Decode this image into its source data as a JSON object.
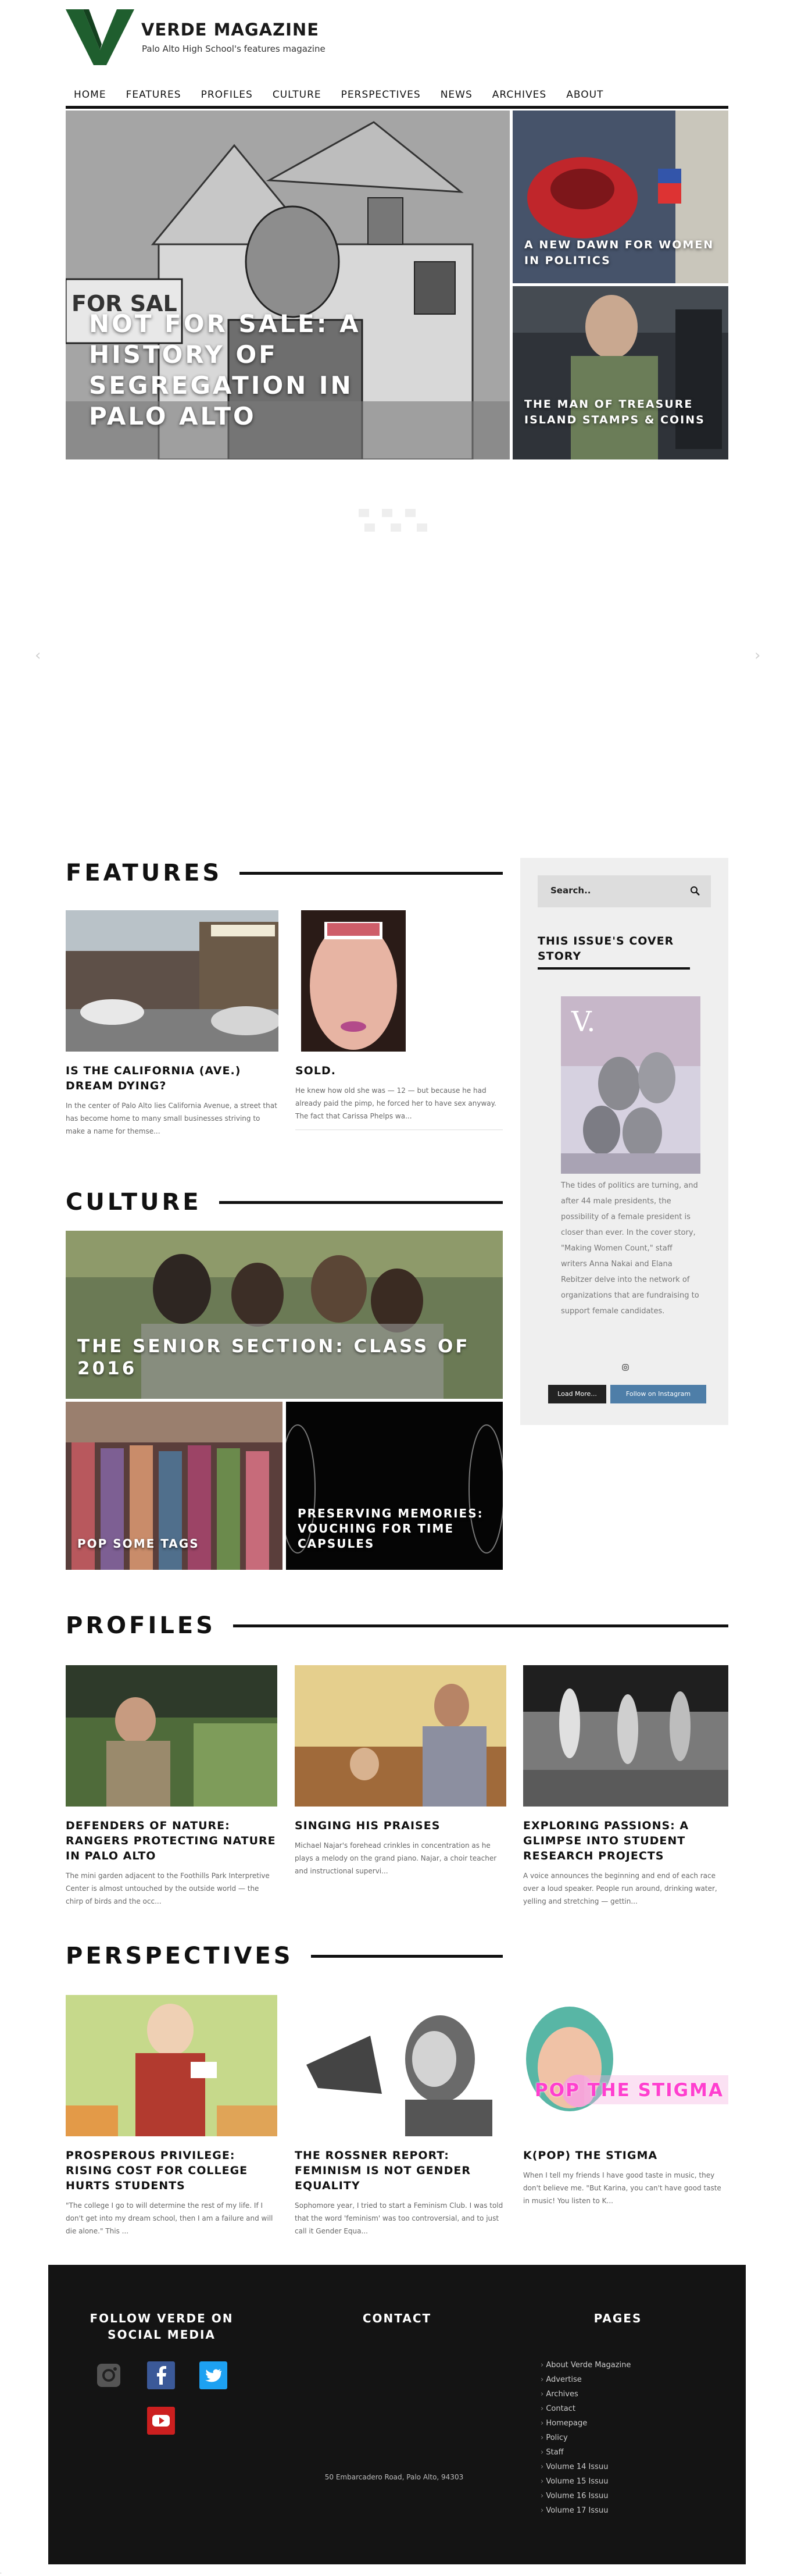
{
  "brand": {
    "title": "VERDE MAGAZINE",
    "subtitle": "Palo Alto High School's features magazine",
    "logo_letter": "V",
    "accent": "#1f5e2e"
  },
  "nav": {
    "items": [
      "HOME",
      "FEATURES",
      "PROFILES",
      "CULTURE",
      "PERSPECTIVES",
      "NEWS",
      "ARCHIVES",
      "ABOUT"
    ]
  },
  "hero": {
    "main_title": "NOT FOR SALE: A HISTORY OF SEGREGATION IN PALO ALTO",
    "side1_title": "A NEW DAWN FOR WOMEN IN POLITICS",
    "side2_title": "THE MAN OF TREASURE ISLAND STAMPS & COINS",
    "prev_arrow": "‹",
    "next_arrow": "›"
  },
  "features": {
    "heading": "FEATURES",
    "cards": [
      {
        "title": "IS THE CALIFORNIA (AVE.) DREAM DYING?",
        "excerpt": "In the center of Palo Alto lies California Avenue, a street that has become home to many small businesses striving to make a name for themse..."
      },
      {
        "title": "SOLD.",
        "excerpt": "He knew how old she was — 12 — but because he had already paid the pimp, he forced her to have sex anyway. The fact that Carissa Phelps wa..."
      }
    ]
  },
  "sidebar": {
    "search_placeholder": "Search..",
    "cover_heading": "THIS ISSUE'S COVER STORY",
    "cover_text": "The tides of politics are turning, and after 44 male presidents, the possibility of a female president is closer than ever. In the cover story, \"Making Women Count,\" staff writers Anna Nakai and Elana Rebitzer delve into the network of organizations that are fundraising to support female candidates.",
    "load_more": "Load More...",
    "follow": "Follow on Instagram"
  },
  "culture": {
    "heading": "CULTURE",
    "main_title": "THE SENIOR SECTION: CLASS OF 2016",
    "sub1_title": "POP SOME TAGS",
    "sub2_title": "PRESERVING MEMORIES: VOUCHING FOR TIME CAPSULES"
  },
  "profiles": {
    "heading": "PROFILES",
    "cards": [
      {
        "title": "DEFENDERS OF NATURE: RANGERS PROTECTING NATURE IN PALO ALTO",
        "excerpt": "The mini garden adjacent to the Foothills Park Interpretive Center is almost untouched by the outside world — the chirp of birds and the occ..."
      },
      {
        "title": "SINGING HIS PRAISES",
        "excerpt": "Michael Najar's forehead crinkles in concentration as he plays a melody on the grand piano. Najar, a choir teacher and instructional supervi..."
      },
      {
        "title": "EXPLORING PASSIONS: A GLIMPSE INTO STUDENT RESEARCH PROJECTS",
        "excerpt": "A voice announces the beginning and end of each race over a loud speaker. People run around, drinking water, yelling and stretching — gettin..."
      }
    ]
  },
  "perspectives": {
    "heading": "PERSPECTIVES",
    "cards": [
      {
        "title": "PROSPEROUS PRIVILEGE: RISING COST FOR COLLEGE HURTS STUDENTS",
        "excerpt": "\"The college I go to will determine the rest of my life. If I don't get into my dream school, then I am a failure and will die alone.\" This ..."
      },
      {
        "title": "THE ROSSNER REPORT: FEMINISM IS NOT GENDER EQUALITY",
        "excerpt": "Sophomore year, I tried to start a Feminism Club. I was told that the word 'feminism' was too controversial, and to just call it Gender Equa..."
      },
      {
        "title": "K(POP) THE STIGMA",
        "excerpt": "When I tell my friends I have good taste in music, they don't believe me. \"But Karina, you can't have good taste in music! You listen to K...",
        "image_text": "POP THE STIGMA"
      }
    ]
  },
  "footer": {
    "social_heading": "FOLLOW VERDE ON SOCIAL MEDIA",
    "contact_heading": "CONTACT",
    "pages_heading": "PAGES",
    "address": "50 Embarcadero Road, Palo Alto, 94303",
    "pages": [
      "About Verde Magazine",
      "Advertise",
      "Archives",
      "Contact",
      "Homepage",
      "Policy",
      "Staff",
      "Volume 14 Issuu",
      "Volume 15 Issuu",
      "Volume 16 Issuu",
      "Volume 17 Issuu"
    ]
  },
  "colors": {
    "facebook": "#3b5998",
    "twitter": "#1da1f2",
    "youtube": "#cc1f1f",
    "instagram": "#555555"
  }
}
